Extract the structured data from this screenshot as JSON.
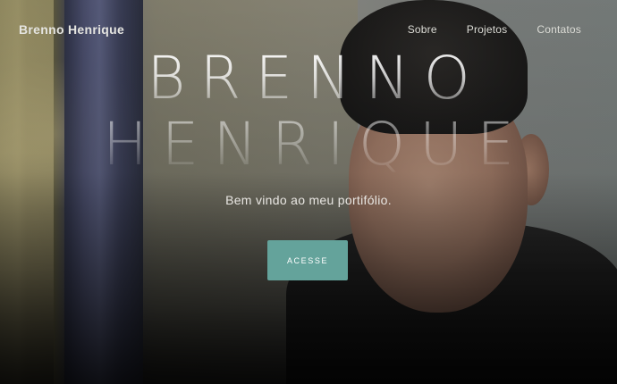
{
  "navbar": {
    "brand": "Brenno Henrique",
    "links": [
      {
        "label": "Sobre"
      },
      {
        "label": "Projetos"
      },
      {
        "label": "Contatos"
      }
    ]
  },
  "hero": {
    "title_line_1": "BRENNO",
    "title_line_2": "HENRIQUE",
    "subtitle": "Bem vindo ao meu portifólio.",
    "cta_label": "ACESSE",
    "cta_color": "#64a39b"
  },
  "background": {
    "image": "portrait photo (hero background)"
  }
}
